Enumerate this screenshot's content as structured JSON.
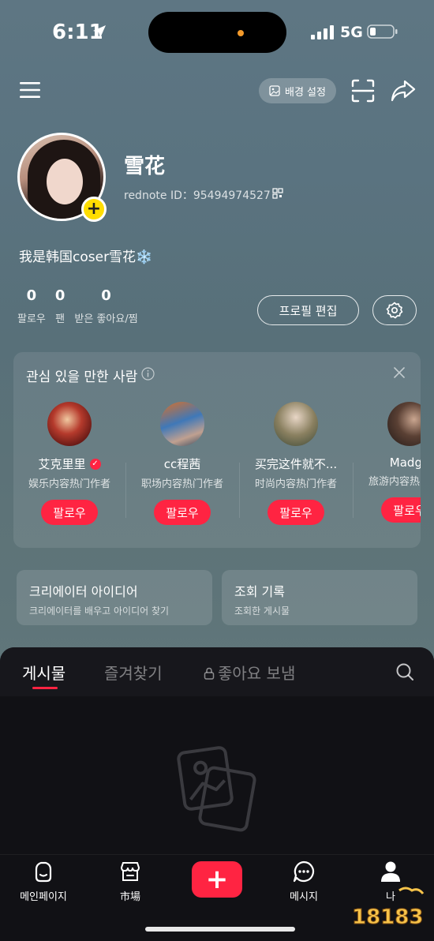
{
  "status_bar": {
    "time": "6:11",
    "network": "5G"
  },
  "header": {
    "background_button": "배경 설정"
  },
  "profile": {
    "name": "雪花",
    "rednote_id": "rednote ID：95494974527",
    "bio": "我是韩国coser雪花❄️",
    "stats": [
      {
        "num": "0",
        "label": "팔로우"
      },
      {
        "num": "0",
        "label": "팬"
      },
      {
        "num": "0",
        "label": "받은 좋아요/찜"
      }
    ],
    "edit_button": "프로필 편집"
  },
  "recommend": {
    "title": "관심 있을 만한 사람",
    "users": [
      {
        "name": "艾克里里",
        "desc": "娱乐内容热门作者",
        "follow": "팔로우",
        "verified": true
      },
      {
        "name": "cc程茜",
        "desc": "职场内容热门作者",
        "follow": "팔로우"
      },
      {
        "name": "买完这件就不...",
        "desc": "时尚内容热门作者",
        "follow": "팔로우"
      },
      {
        "name": "Madge",
        "desc": "旅游内容热门作者",
        "follow": "팔로우"
      }
    ]
  },
  "quick_cards": [
    {
      "title": "크리에이터 아이디어",
      "sub": "크리에이터를 배우고 아이디어 찾기"
    },
    {
      "title": "조회 기록",
      "sub": "조회한 게시물"
    }
  ],
  "tabs": [
    "게시물",
    "즐겨찾기",
    "좋아요 보냄"
  ],
  "bottom_nav": {
    "home": "메인페이지",
    "market": "市場",
    "messages": "메시지",
    "me": "나"
  },
  "watermark": "18183",
  "colors": {
    "accent": "#ff2442",
    "badge": "#ffdd00"
  }
}
